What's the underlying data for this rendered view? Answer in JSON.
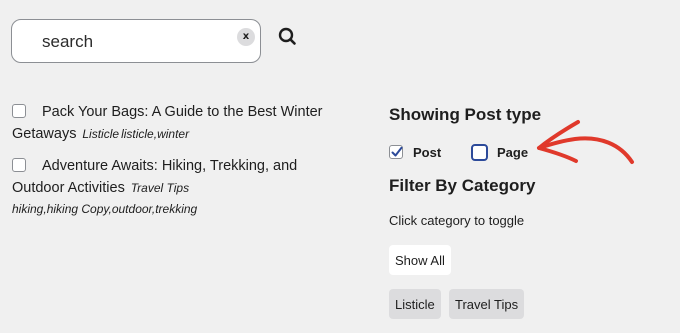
{
  "search": {
    "placeholder": "search",
    "value": "",
    "clear_label": "x"
  },
  "results": [
    {
      "title": "Pack Your Bags: A Guide to the Best Winter Getaways",
      "title_line1": "Pack Your Bags: A Guide to the Best Winter",
      "title_line2": "Getaways",
      "category": "Listicle",
      "tags": "listicle,winter"
    },
    {
      "title": "Adventure Awaits: Hiking, Trekking, and Outdoor Activities",
      "title_line1": "Adventure Awaits: Hiking, Trekking, and",
      "title_line2": "Outdoor Activities",
      "category": "Travel Tips",
      "tags": "hiking,hiking Copy,outdoor,trekking"
    }
  ],
  "sidebar": {
    "post_type_heading": "Showing Post type",
    "post_types": [
      {
        "label": "Post",
        "checked": true
      },
      {
        "label": "Page",
        "checked": false
      }
    ],
    "filter_heading": "Filter By Category",
    "hint": "Click category to toggle",
    "show_all_label": "Show All",
    "categories": [
      {
        "label": "Listicle"
      },
      {
        "label": "Travel Tips"
      }
    ]
  },
  "colors": {
    "background": "#f0f0f0",
    "annotation_arrow": "#e0392b",
    "focus_border": "#2c4a9a",
    "category_button": "#dcdcde"
  },
  "icons": {
    "search": "magnifier-icon",
    "arrow": "annotation-arrow-icon"
  }
}
